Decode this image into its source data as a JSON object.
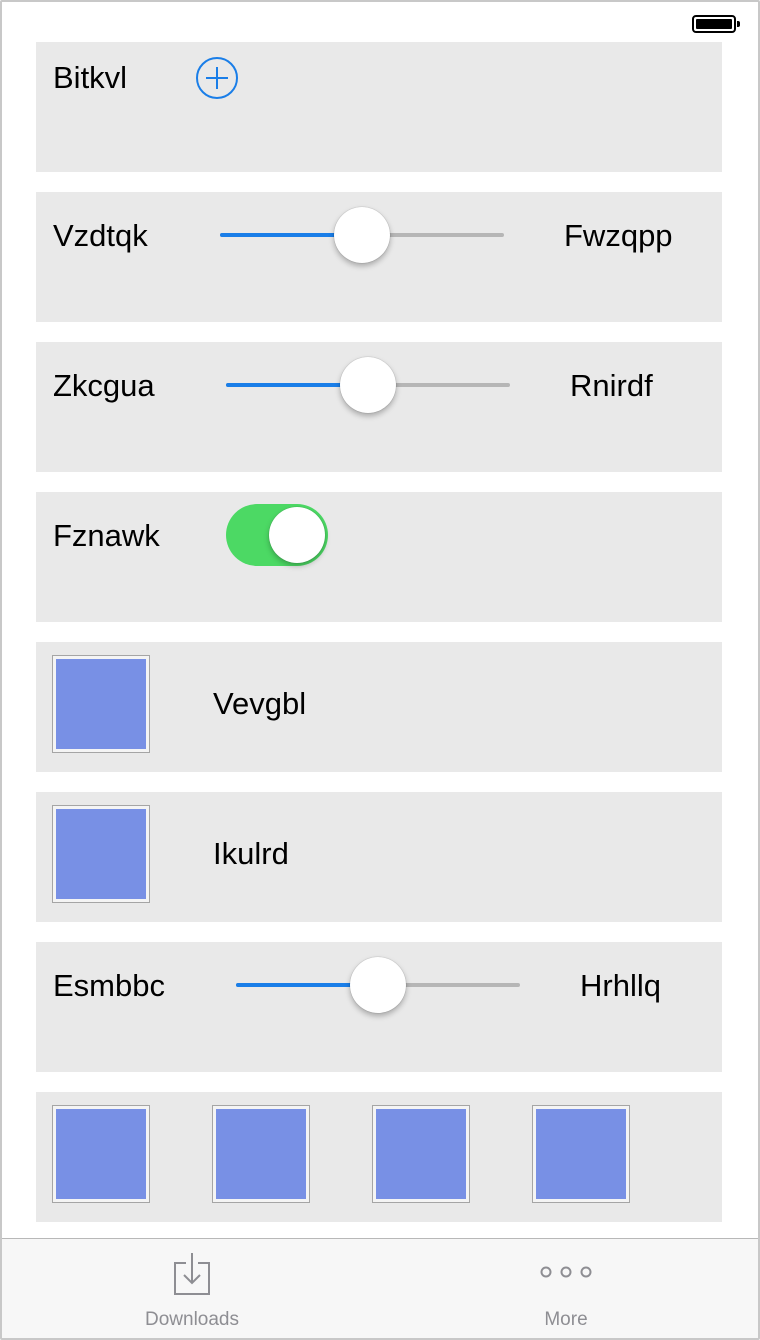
{
  "status_bar": {
    "battery_icon": "battery-full-icon"
  },
  "rows": {
    "bitkvl": {
      "label": "Bitkvl",
      "icon": "plus-circle-icon"
    },
    "vzdtqk": {
      "label_left": "Vzdtqk",
      "label_right": "Fwzqpp",
      "value": 0.5
    },
    "zkcgua": {
      "label_left": "Zkcgua",
      "label_right": "Rnirdf",
      "value": 0.5
    },
    "fznawk": {
      "label": "Fznawk",
      "on": true
    },
    "vevgbl": {
      "label": "Vevgbl",
      "swatch_color": "#7890e5"
    },
    "ikulrd": {
      "label": "Ikulrd",
      "swatch_color": "#7890e5"
    },
    "esmbbc": {
      "label_left": "Esmbbc",
      "label_right": "Hrhllq",
      "value": 0.5
    },
    "swatches": {
      "count": 4,
      "color": "#7890e5"
    }
  },
  "tab_bar": {
    "downloads": {
      "label": "Downloads",
      "icon": "download-tray-icon"
    },
    "more": {
      "label": "More",
      "icon": "more-dots-icon"
    }
  },
  "colors": {
    "accent": "#1a7ee8",
    "toggle_on": "#4cd964",
    "card_bg": "#e9e9e9"
  }
}
